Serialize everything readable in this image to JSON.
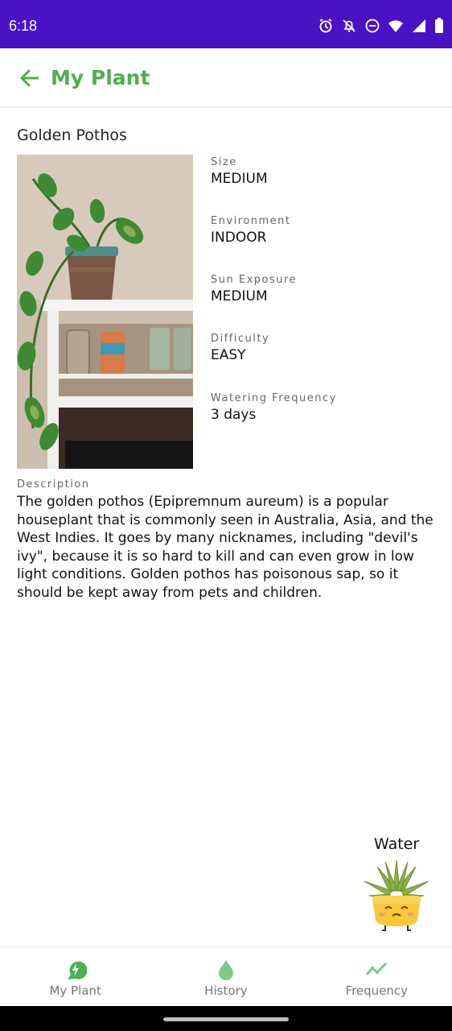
{
  "status_bar": {
    "time": "6:18",
    "icons": [
      "alarm-icon",
      "notifications-off-icon",
      "do-not-disturb-icon",
      "wifi-icon",
      "signal-icon",
      "battery-icon"
    ]
  },
  "app_bar": {
    "title": "My Plant",
    "accent": "#4caf50"
  },
  "plant": {
    "name": "Golden Pothos",
    "attributes": [
      {
        "label": "Size",
        "value": "MEDIUM"
      },
      {
        "label": "Environment",
        "value": "INDOOR"
      },
      {
        "label": "Sun Exposure",
        "value": "MEDIUM"
      },
      {
        "label": "Difficulty",
        "value": "EASY"
      },
      {
        "label": "Watering Frequency",
        "value": "3 days"
      }
    ],
    "description_label": "Description",
    "description": "The golden pothos (Epipremnum aureum) is a popular houseplant that is commonly seen in Australia, Asia, and the West Indies. It goes by many nicknames, including \"devil's ivy\", because it is so hard to kill and can even grow in low light conditions. Golden pothos has poisonous sap, so it should be kept away from pets and children."
  },
  "water": {
    "label": "Water"
  },
  "bottom_nav": {
    "items": [
      {
        "label": "My Plant",
        "icon": "plant-bolt-icon"
      },
      {
        "label": "History",
        "icon": "water-drop-icon"
      },
      {
        "label": "Frequency",
        "icon": "trend-line-icon"
      }
    ]
  },
  "colors": {
    "status_bar": "#4a12c4",
    "accent_green": "#4caf50"
  }
}
